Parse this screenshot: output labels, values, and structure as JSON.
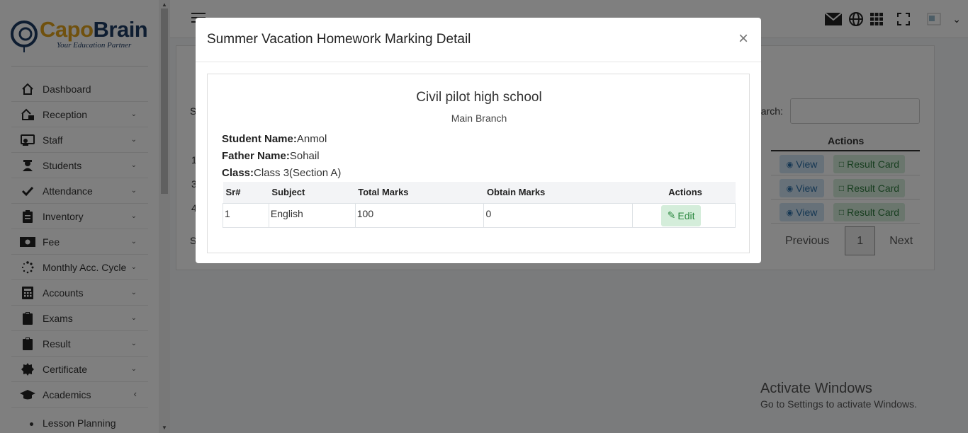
{
  "logo": {
    "part1": "Capo",
    "part2": "Brain",
    "tagline": "Your Education Partner"
  },
  "sidebar": {
    "items": [
      {
        "label": "Dashboard",
        "icon": "home-icon",
        "has_chevron": false
      },
      {
        "label": "Reception",
        "icon": "reception-icon",
        "has_chevron": true
      },
      {
        "label": "Staff",
        "icon": "staff-icon",
        "has_chevron": true
      },
      {
        "label": "Students",
        "icon": "students-icon",
        "has_chevron": true
      },
      {
        "label": "Attendance",
        "icon": "check-icon",
        "has_chevron": true
      },
      {
        "label": "Inventory",
        "icon": "clipboard-list-icon",
        "has_chevron": true
      },
      {
        "label": "Fee",
        "icon": "money-icon",
        "has_chevron": true
      },
      {
        "label": "Monthly Acc. Cycle",
        "icon": "spinner-icon",
        "has_chevron": true
      },
      {
        "label": "Accounts",
        "icon": "calculator-icon",
        "has_chevron": true
      },
      {
        "label": "Exams",
        "icon": "clipboard-icon",
        "has_chevron": true
      },
      {
        "label": "Result",
        "icon": "clipboard-icon",
        "has_chevron": true
      },
      {
        "label": "Certificate",
        "icon": "certificate-icon",
        "has_chevron": true
      },
      {
        "label": "Academics",
        "icon": "graduation-cap-icon",
        "has_chevron": true
      }
    ],
    "sub_item": "Lesson Planning"
  },
  "background": {
    "search_label": "earch:",
    "actions_header": "Actions",
    "rows": [
      {
        "view": "View",
        "result_card": "Result Card",
        "left": "1"
      },
      {
        "view": "View",
        "result_card": "Result Card",
        "left": "3"
      },
      {
        "view": "View",
        "result_card": "Result Card",
        "left": "4"
      }
    ],
    "pager": {
      "previous": "Previous",
      "page": "1",
      "next": "Next"
    },
    "left_fragments": {
      "a": "S",
      "b": "S",
      "c": "S"
    }
  },
  "watermark": {
    "line1": "Activate Windows",
    "line2": "Go to Settings to activate Windows."
  },
  "modal": {
    "title": "Summer Vacation Homework Marking Detail",
    "close": "×",
    "school": "Civil pilot high school",
    "branch": "Main Branch",
    "student_label": "Student Name:",
    "student_value": "Anmol",
    "father_label": "Father Name:",
    "father_value": "Sohail",
    "class_label": "Class:",
    "class_value": "Class 3(Section A)",
    "table": {
      "headers": [
        "Sr#",
        "Subject",
        "Total Marks",
        "Obtain Marks",
        "Actions"
      ],
      "rows": [
        {
          "sr": "1",
          "subject": "English",
          "total": "100",
          "obtain": "0",
          "action": "Edit"
        }
      ]
    }
  },
  "colors": {
    "accent_gold": "#e0a21c",
    "brand_navy": "#1d3a63",
    "success": "#2f8a43",
    "info": "#2b6ea6"
  }
}
